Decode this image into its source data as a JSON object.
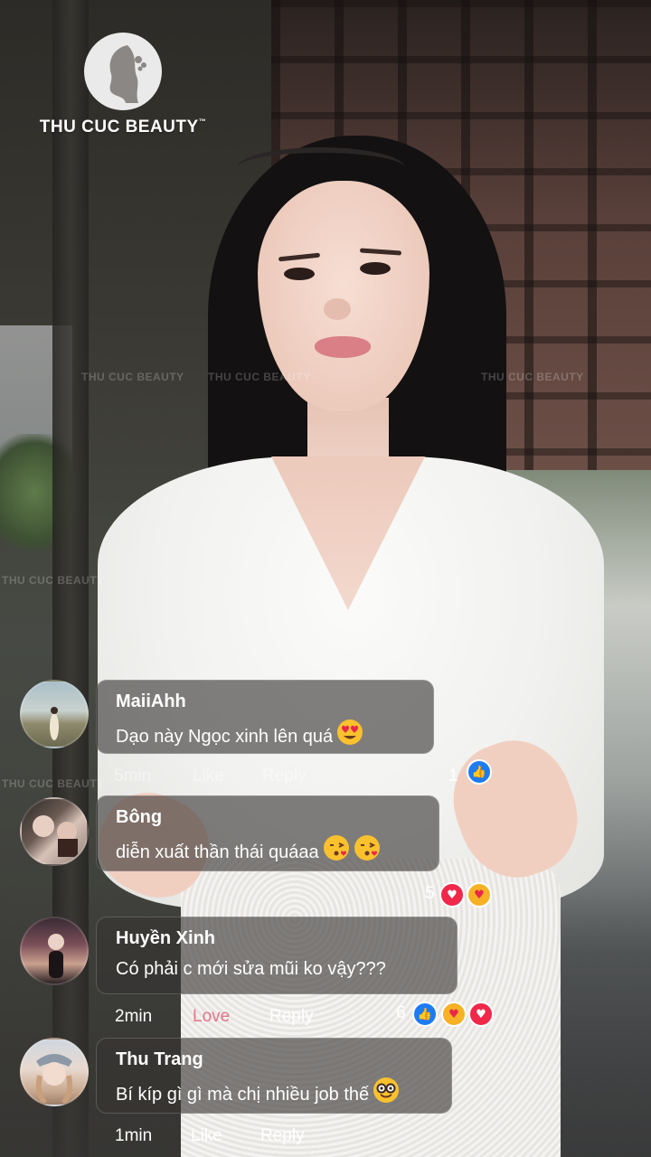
{
  "brand": {
    "logo_text": "THU CUC BEAUTY",
    "trademark": "™",
    "watermark_text": "THU CUC BEAUTY"
  },
  "comments": [
    {
      "author": "MaiiAhh",
      "text": "Dạo này Ngọc xinh lên quá",
      "emoji": "heart-eyes",
      "time": "5min",
      "like_label": "Like",
      "reply_label": "Reply",
      "reaction_count": "1",
      "reactions": [
        "like"
      ]
    },
    {
      "author": "Bông",
      "text": "diễn xuất thần thái quáaa",
      "emoji": "kiss-kiss",
      "reaction_count": "5",
      "reactions": [
        "love",
        "care"
      ]
    },
    {
      "author": "Huyền Xinh",
      "text": "Có phải c mới sửa mũi ko vậy???",
      "time": "2min",
      "like_label": "Love",
      "reply_label": "Reply",
      "reaction_count": "6",
      "reactions": [
        "like",
        "care",
        "love"
      ]
    },
    {
      "author": "Thu Trang",
      "text": "Bí kíp gì gì mà chị nhiều job thế",
      "emoji": "nerd",
      "time": "1min",
      "like_label": "Like",
      "reply_label": "Reply"
    }
  ],
  "colors": {
    "like_blue": "#1d7cf2",
    "love_red": "#f0284a",
    "care_yellow": "#f7b125",
    "love_label": "#e2435e"
  }
}
